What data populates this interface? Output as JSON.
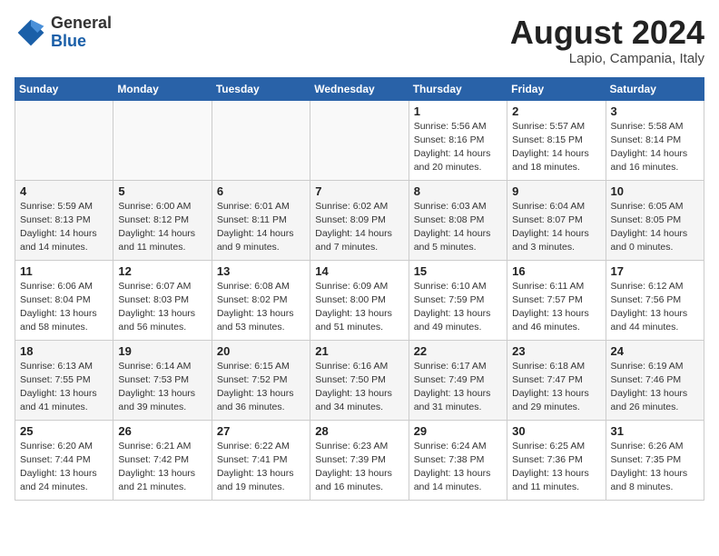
{
  "header": {
    "logo_general": "General",
    "logo_blue": "Blue",
    "month_year": "August 2024",
    "location": "Lapio, Campania, Italy"
  },
  "weekdays": [
    "Sunday",
    "Monday",
    "Tuesday",
    "Wednesday",
    "Thursday",
    "Friday",
    "Saturday"
  ],
  "weeks": [
    [
      {
        "day": "",
        "info": ""
      },
      {
        "day": "",
        "info": ""
      },
      {
        "day": "",
        "info": ""
      },
      {
        "day": "",
        "info": ""
      },
      {
        "day": "1",
        "info": "Sunrise: 5:56 AM\nSunset: 8:16 PM\nDaylight: 14 hours and 20 minutes."
      },
      {
        "day": "2",
        "info": "Sunrise: 5:57 AM\nSunset: 8:15 PM\nDaylight: 14 hours and 18 minutes."
      },
      {
        "day": "3",
        "info": "Sunrise: 5:58 AM\nSunset: 8:14 PM\nDaylight: 14 hours and 16 minutes."
      }
    ],
    [
      {
        "day": "4",
        "info": "Sunrise: 5:59 AM\nSunset: 8:13 PM\nDaylight: 14 hours and 14 minutes."
      },
      {
        "day": "5",
        "info": "Sunrise: 6:00 AM\nSunset: 8:12 PM\nDaylight: 14 hours and 11 minutes."
      },
      {
        "day": "6",
        "info": "Sunrise: 6:01 AM\nSunset: 8:11 PM\nDaylight: 14 hours and 9 minutes."
      },
      {
        "day": "7",
        "info": "Sunrise: 6:02 AM\nSunset: 8:09 PM\nDaylight: 14 hours and 7 minutes."
      },
      {
        "day": "8",
        "info": "Sunrise: 6:03 AM\nSunset: 8:08 PM\nDaylight: 14 hours and 5 minutes."
      },
      {
        "day": "9",
        "info": "Sunrise: 6:04 AM\nSunset: 8:07 PM\nDaylight: 14 hours and 3 minutes."
      },
      {
        "day": "10",
        "info": "Sunrise: 6:05 AM\nSunset: 8:05 PM\nDaylight: 14 hours and 0 minutes."
      }
    ],
    [
      {
        "day": "11",
        "info": "Sunrise: 6:06 AM\nSunset: 8:04 PM\nDaylight: 13 hours and 58 minutes."
      },
      {
        "day": "12",
        "info": "Sunrise: 6:07 AM\nSunset: 8:03 PM\nDaylight: 13 hours and 56 minutes."
      },
      {
        "day": "13",
        "info": "Sunrise: 6:08 AM\nSunset: 8:02 PM\nDaylight: 13 hours and 53 minutes."
      },
      {
        "day": "14",
        "info": "Sunrise: 6:09 AM\nSunset: 8:00 PM\nDaylight: 13 hours and 51 minutes."
      },
      {
        "day": "15",
        "info": "Sunrise: 6:10 AM\nSunset: 7:59 PM\nDaylight: 13 hours and 49 minutes."
      },
      {
        "day": "16",
        "info": "Sunrise: 6:11 AM\nSunset: 7:57 PM\nDaylight: 13 hours and 46 minutes."
      },
      {
        "day": "17",
        "info": "Sunrise: 6:12 AM\nSunset: 7:56 PM\nDaylight: 13 hours and 44 minutes."
      }
    ],
    [
      {
        "day": "18",
        "info": "Sunrise: 6:13 AM\nSunset: 7:55 PM\nDaylight: 13 hours and 41 minutes."
      },
      {
        "day": "19",
        "info": "Sunrise: 6:14 AM\nSunset: 7:53 PM\nDaylight: 13 hours and 39 minutes."
      },
      {
        "day": "20",
        "info": "Sunrise: 6:15 AM\nSunset: 7:52 PM\nDaylight: 13 hours and 36 minutes."
      },
      {
        "day": "21",
        "info": "Sunrise: 6:16 AM\nSunset: 7:50 PM\nDaylight: 13 hours and 34 minutes."
      },
      {
        "day": "22",
        "info": "Sunrise: 6:17 AM\nSunset: 7:49 PM\nDaylight: 13 hours and 31 minutes."
      },
      {
        "day": "23",
        "info": "Sunrise: 6:18 AM\nSunset: 7:47 PM\nDaylight: 13 hours and 29 minutes."
      },
      {
        "day": "24",
        "info": "Sunrise: 6:19 AM\nSunset: 7:46 PM\nDaylight: 13 hours and 26 minutes."
      }
    ],
    [
      {
        "day": "25",
        "info": "Sunrise: 6:20 AM\nSunset: 7:44 PM\nDaylight: 13 hours and 24 minutes."
      },
      {
        "day": "26",
        "info": "Sunrise: 6:21 AM\nSunset: 7:42 PM\nDaylight: 13 hours and 21 minutes."
      },
      {
        "day": "27",
        "info": "Sunrise: 6:22 AM\nSunset: 7:41 PM\nDaylight: 13 hours and 19 minutes."
      },
      {
        "day": "28",
        "info": "Sunrise: 6:23 AM\nSunset: 7:39 PM\nDaylight: 13 hours and 16 minutes."
      },
      {
        "day": "29",
        "info": "Sunrise: 6:24 AM\nSunset: 7:38 PM\nDaylight: 13 hours and 14 minutes."
      },
      {
        "day": "30",
        "info": "Sunrise: 6:25 AM\nSunset: 7:36 PM\nDaylight: 13 hours and 11 minutes."
      },
      {
        "day": "31",
        "info": "Sunrise: 6:26 AM\nSunset: 7:35 PM\nDaylight: 13 hours and 8 minutes."
      }
    ]
  ]
}
